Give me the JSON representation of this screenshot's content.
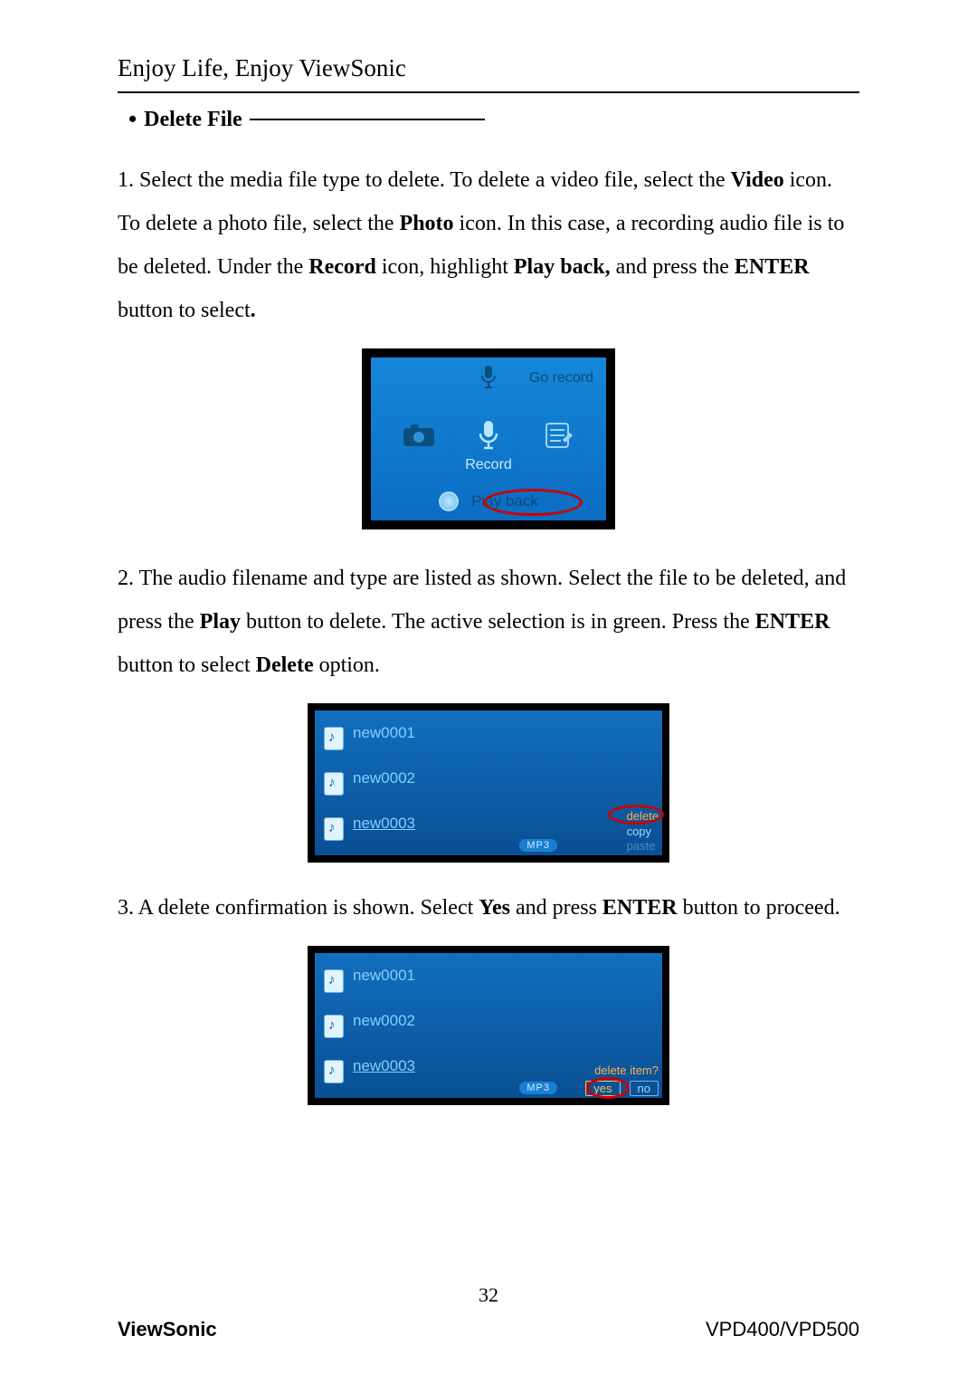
{
  "header": {
    "tagline": "Enjoy Life, Enjoy ViewSonic"
  },
  "section": {
    "title": "Delete File"
  },
  "step1": {
    "prefix": "1. Select the media file type to delete. To delete a video file, select the ",
    "video": "Video",
    "mid1": " icon. To delete a photo file, select the ",
    "photo": "Photo",
    "mid2": " icon. In this case, a recording audio file is to be deleted. Under the ",
    "record": "Record",
    "mid3": " icon, highlight ",
    "playback": "Play back,",
    "mid4": " and press the ",
    "enter": "ENTER",
    "tail": " button to select",
    "period": "."
  },
  "fig1": {
    "go_record": "Go record",
    "record_label": "Record",
    "playback_label": "Play back"
  },
  "step2": {
    "prefix": "2. The audio filename and type are listed as shown. Select the file to be deleted, and press the ",
    "play": "Play",
    "mid1": " button to delete. The active selection is in green. Press the ",
    "enter": "ENTER",
    "mid2": " button to select ",
    "delete": "Delete",
    "tail": " option."
  },
  "fig2": {
    "files": [
      "new0001",
      "new0002",
      "new0003"
    ],
    "badge": "MP3",
    "ctx": {
      "delete": "delete",
      "copy": "copy",
      "paste": "paste"
    }
  },
  "step3": {
    "prefix": "3. A delete confirmation is shown. Select ",
    "yes": "Yes",
    "mid": " and press ",
    "enter": "ENTER",
    "tail": " button to proceed."
  },
  "fig3": {
    "files": [
      "new0001",
      "new0002",
      "new0003"
    ],
    "badge": "MP3",
    "confirm": {
      "q": "delete item?",
      "yes": "yes",
      "no": "no"
    }
  },
  "footer": {
    "page": "32",
    "brand": "ViewSonic",
    "model": "VPD400/VPD500"
  }
}
